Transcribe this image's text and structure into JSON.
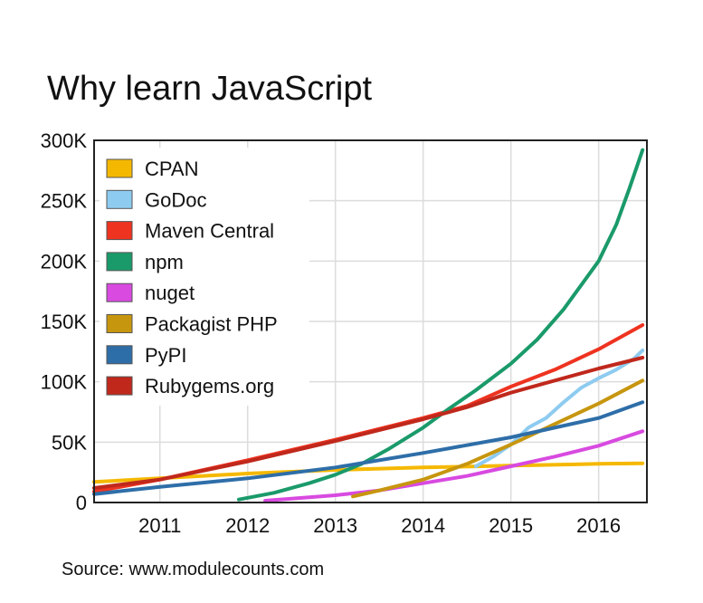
{
  "chart_data": {
    "type": "line",
    "title": "Why learn JavaScript",
    "source": "Source: www.modulecounts.com",
    "xlabel": "",
    "ylabel": "",
    "xlim": [
      2010.25,
      2016.55
    ],
    "ylim": [
      0,
      300000
    ],
    "grid": true,
    "legend_position": "top-left",
    "x_ticks": [
      {
        "value": 2011,
        "label": "2011"
      },
      {
        "value": 2012,
        "label": "2012"
      },
      {
        "value": 2013,
        "label": "2013"
      },
      {
        "value": 2014,
        "label": "2014"
      },
      {
        "value": 2015,
        "label": "2015"
      },
      {
        "value": 2016,
        "label": "2016"
      }
    ],
    "y_ticks": [
      {
        "value": 0,
        "label": "0"
      },
      {
        "value": 50000,
        "label": "50K"
      },
      {
        "value": 100000,
        "label": "100K"
      },
      {
        "value": 150000,
        "label": "150K"
      },
      {
        "value": 200000,
        "label": "200K"
      },
      {
        "value": 250000,
        "label": "250K"
      },
      {
        "value": 300000,
        "label": "300K"
      }
    ],
    "series": [
      {
        "name": "CPAN",
        "color": "#f5b800",
        "x": [
          2010.25,
          2011,
          2012,
          2013,
          2014,
          2015,
          2016,
          2016.5
        ],
        "y": [
          17000,
          20000,
          24000,
          27000,
          29000,
          30500,
          32000,
          32500
        ]
      },
      {
        "name": "GoDoc",
        "color": "#8ecbf0",
        "x": [
          2014.6,
          2014.8,
          2015.0,
          2015.2,
          2015.4,
          2015.6,
          2015.8,
          2016.0,
          2016.2,
          2016.4,
          2016.5
        ],
        "y": [
          30000,
          38000,
          48000,
          62000,
          70000,
          83000,
          95000,
          103000,
          110000,
          119000,
          126000
        ]
      },
      {
        "name": "Maven Central",
        "color": "#ee3320",
        "x": [
          2010.25,
          2011,
          2012,
          2013,
          2014,
          2014.5,
          2015,
          2015.5,
          2016,
          2016.5
        ],
        "y": [
          9000,
          19000,
          35000,
          52000,
          70000,
          80000,
          96000,
          110000,
          127000,
          147000
        ]
      },
      {
        "name": "npm",
        "color": "#1a9a6a",
        "x": [
          2011.9,
          2012.3,
          2012.7,
          2013,
          2013.3,
          2013.6,
          2014,
          2014.3,
          2014.6,
          2015,
          2015.3,
          2015.6,
          2016,
          2016.2,
          2016.35,
          2016.5
        ],
        "y": [
          2500,
          8000,
          16000,
          23000,
          32000,
          44000,
          62000,
          78000,
          93000,
          115000,
          135000,
          160000,
          200000,
          230000,
          260000,
          292000
        ]
      },
      {
        "name": "nuget",
        "color": "#d84ae0",
        "x": [
          2012.2,
          2013,
          2013.5,
          2014,
          2014.5,
          2015,
          2015.5,
          2016,
          2016.5
        ],
        "y": [
          1500,
          6000,
          10000,
          16000,
          22000,
          30000,
          38000,
          47000,
          59000
        ]
      },
      {
        "name": "Packagist PHP",
        "color": "#c7960f",
        "x": [
          2013.2,
          2013.5,
          2014,
          2014.5,
          2015,
          2015.5,
          2016,
          2016.5
        ],
        "y": [
          5000,
          10000,
          19000,
          32000,
          48000,
          65000,
          82000,
          101000
        ]
      },
      {
        "name": "PyPI",
        "color": "#2e6ea8",
        "x": [
          2010.25,
          2011,
          2012,
          2013,
          2014,
          2015,
          2016,
          2016.5
        ],
        "y": [
          7000,
          13000,
          20000,
          29000,
          41000,
          54000,
          70000,
          83000
        ]
      },
      {
        "name": "Rubygems.org",
        "color": "#c0281c",
        "x": [
          2010.25,
          2011,
          2012,
          2013,
          2014,
          2014.5,
          2015,
          2015.5,
          2016,
          2016.5
        ],
        "y": [
          12000,
          19000,
          34000,
          51000,
          69000,
          79000,
          91000,
          101000,
          111000,
          120000
        ]
      }
    ]
  }
}
